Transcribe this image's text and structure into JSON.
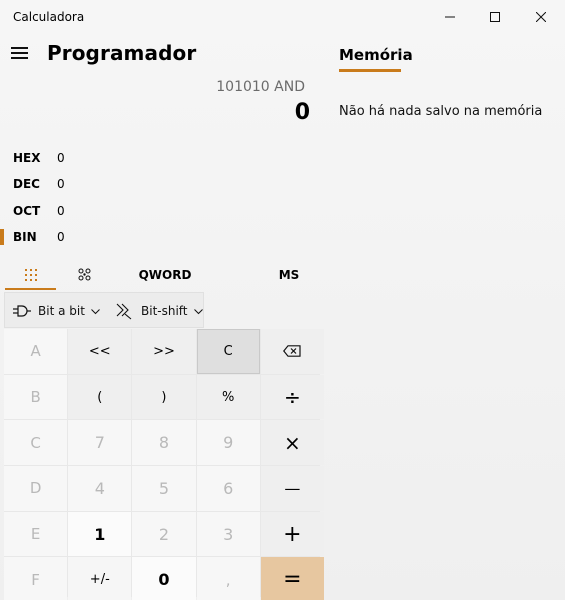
{
  "window": {
    "title": "Calculadora"
  },
  "header": {
    "mode_title": "Programador"
  },
  "display": {
    "expression": "101010 AND",
    "value": "0"
  },
  "radix": [
    {
      "label": "HEX",
      "value": "0",
      "active": false
    },
    {
      "label": "DEC",
      "value": "0",
      "active": false
    },
    {
      "label": "OCT",
      "value": "0",
      "active": false
    },
    {
      "label": "BIN",
      "value": "0",
      "active": true
    }
  ],
  "keypad_tabs": {
    "word_size": "QWORD",
    "memory_store": "MS"
  },
  "dropdowns": {
    "bitwise": "Bit a bit",
    "bitshift": "Bit-shift"
  },
  "keys": [
    [
      "A",
      "<<",
      ">>",
      "C",
      "⌫"
    ],
    [
      "B",
      "(",
      ")",
      "%",
      "÷"
    ],
    [
      "C",
      "7",
      "8",
      "9",
      "×"
    ],
    [
      "D",
      "4",
      "5",
      "6",
      "—"
    ],
    [
      "E",
      "1",
      "2",
      "3",
      "+"
    ],
    [
      "F",
      "+/-",
      "0",
      ",",
      "="
    ]
  ],
  "memory": {
    "title": "Memória",
    "empty_message": "Não há nada salvo na memória"
  },
  "colors": {
    "accent": "#c97b1b",
    "equals_key": "#e7c7a0",
    "disabled_text": "#b9b9b9"
  }
}
